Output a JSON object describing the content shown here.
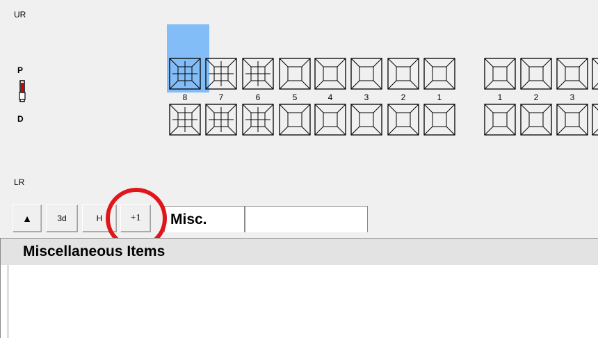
{
  "chart": {
    "upper_right_label": "UR",
    "lower_right_label": "LR",
    "side_top": "P",
    "side_bottom": "D",
    "upper_numbers": [
      "8",
      "7",
      "6",
      "5",
      "4",
      "3",
      "2",
      "1",
      "1",
      "2",
      "3"
    ],
    "selected_tooth": "8"
  },
  "toolbar": {
    "up_icon": "up-arrow-icon",
    "btn_3d": "3d",
    "btn_h": "H",
    "btn_plus1": "+1"
  },
  "tabs": [
    {
      "label": "Misc."
    },
    {
      "label": ""
    }
  ],
  "panel": {
    "title": "Miscellaneous Items"
  },
  "colors": {
    "selection": "#82bdf7",
    "annotation": "#e0161b",
    "header_bg": "#e3e3e3",
    "app_bg": "#f0f0f0"
  }
}
